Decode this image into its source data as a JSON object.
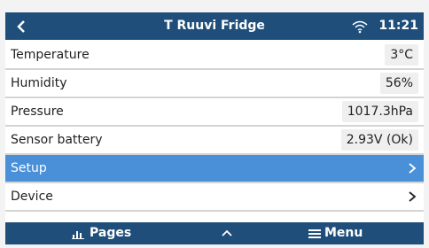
{
  "header": {
    "title": "T Ruuvi Fridge",
    "time": "11:21",
    "back_icon": "chevron-left-icon",
    "signal_icon": "wifi-icon"
  },
  "rows": [
    {
      "label": "Temperature",
      "value": "3°C"
    },
    {
      "label": "Humidity",
      "value": "56%"
    },
    {
      "label": "Pressure",
      "value": "1017.3hPa"
    },
    {
      "label": "Sensor battery",
      "value": "2.93V (Ok)"
    },
    {
      "label": "Setup",
      "selected": true
    },
    {
      "label": "Device"
    }
  ],
  "footer": {
    "pages_label": "Pages",
    "menu_label": "Menu",
    "pages_icon": "bar-chart-icon",
    "up_icon": "chevron-up-icon",
    "menu_icon": "hamburger-icon"
  },
  "colors": {
    "header_bg": "#1f4e7a",
    "selected_bg": "#4a90d9"
  }
}
